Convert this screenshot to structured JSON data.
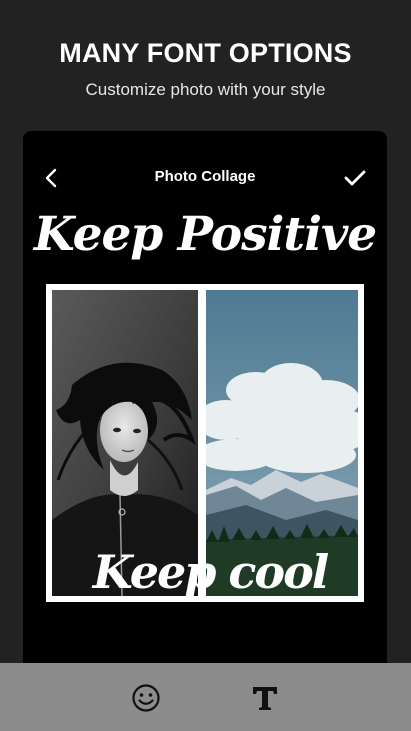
{
  "promo": {
    "headline": "MANY FONT OPTIONS",
    "subhead": "Customize photo with your style"
  },
  "editor": {
    "title": "Photo Collage",
    "back_icon": "chevron-left-icon",
    "confirm_icon": "check-icon",
    "text_top": "Keep Positive",
    "text_bottom": "Keep cool",
    "collage": {
      "layout": "two-column",
      "border_color": "#ffffff",
      "cells": [
        {
          "content": "black-and-white portrait of a woman with windswept hair"
        },
        {
          "content": "mountain landscape with clouds and forest"
        }
      ]
    }
  },
  "toolbar": {
    "items": [
      {
        "icon": "emoji-sticker-icon"
      },
      {
        "icon": "text-tool-icon"
      }
    ]
  },
  "colors": {
    "background": "#222222",
    "canvas": "#000000",
    "toolbar": "#8c8c8c"
  }
}
